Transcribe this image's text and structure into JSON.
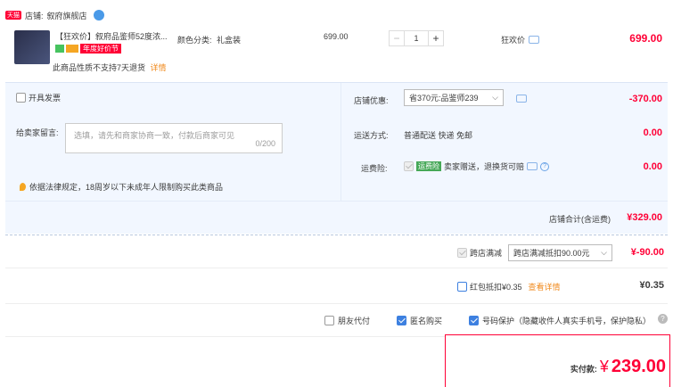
{
  "shop": {
    "badge": "天猫",
    "label": "店铺: ",
    "name": "叙府旗舰店"
  },
  "item": {
    "title": "【狂欢价】叙府品鉴师52度浓...",
    "spec_label": "颜色分类:",
    "spec_value": "礼盒装",
    "price": "699.00",
    "qty": "1",
    "promo_tag": "狂欢价",
    "subtotal": "699.00",
    "event_badge": "年度好价节",
    "notice": "此商品性质不支持7天退货",
    "notice_link": "详情"
  },
  "invoice": {
    "label": "开具发票"
  },
  "message": {
    "label": "给卖家留言:",
    "placeholder": "选填，请先和商家协商一致，付款后商家可见",
    "counter": "0/200"
  },
  "notice": "依据法律规定，18周岁以下未成年人限制购买此类商品",
  "discount": {
    "label": "店铺优惠:",
    "select": "省370元:品鉴师239",
    "amount": "-370.00"
  },
  "shipping": {
    "label": "运送方式:",
    "method": "普通配送 快递 免邮",
    "amount": "0.00"
  },
  "insurance": {
    "label": "运费险:",
    "badge": "运费险",
    "text": "卖家赠送，退换货可赔",
    "amount": "0.00"
  },
  "shop_total": {
    "label": "店铺合计(含运费)",
    "amount": "¥329.00"
  },
  "cross_discount": {
    "label": "跨店满减",
    "select": "跨店满减抵扣90.00元",
    "amount": "¥-90.00"
  },
  "redpacket": {
    "label": "红包抵扣¥0.35",
    "link": "查看详情",
    "amount": "¥0.35"
  },
  "options": {
    "friend_pay": "朋友代付",
    "anonymous": "匿名购买",
    "number_protect": "号码保护（隐藏收件人真实手机号，保护隐私）"
  },
  "payment": {
    "label": "实付款:",
    "currency": "¥",
    "amount": "239.00"
  },
  "colors": {
    "accent": "#ff0036",
    "blue": "#3d80e0",
    "band": "#f2f7ff"
  }
}
